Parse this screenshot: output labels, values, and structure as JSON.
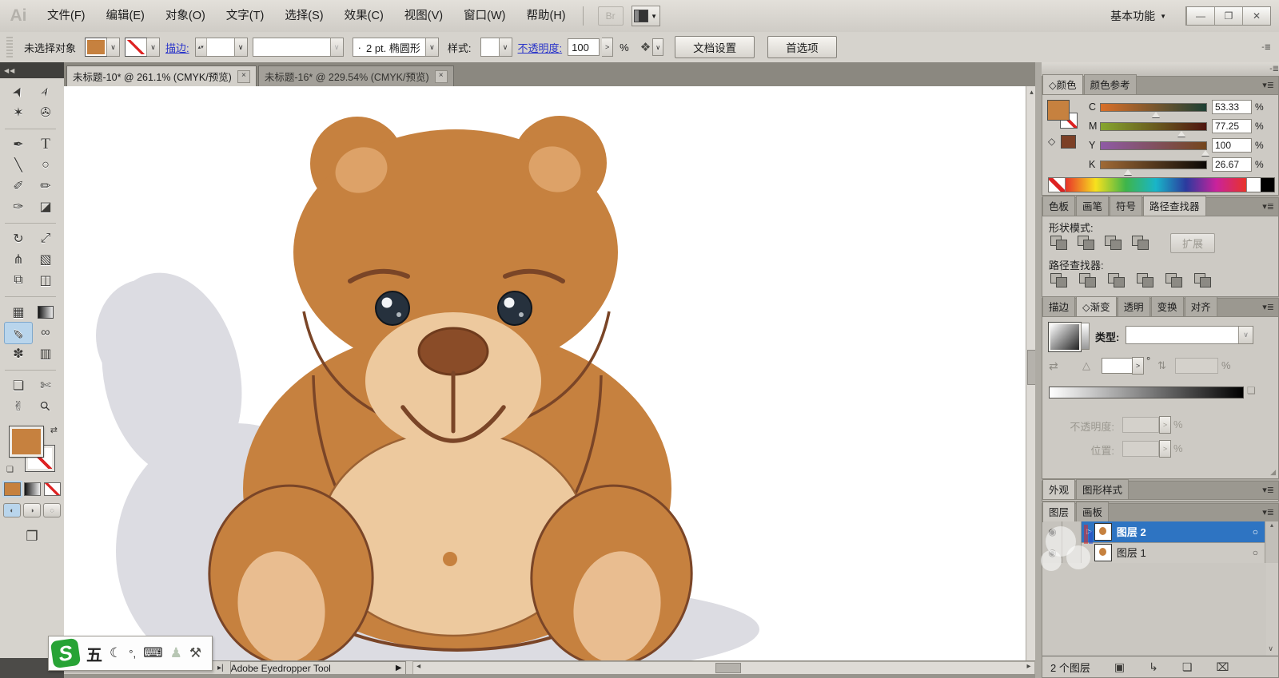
{
  "palette": {
    "ui": {
      "chrome": "#d6d3cd",
      "dark": "#8b8880",
      "panel": "#cdcac4",
      "link": "#2b35c9",
      "selBlue": "#2e74c2",
      "toolSel": "#b9d5ec",
      "scrollThumb": "#b5b2ac"
    },
    "bear": {
      "body": "#c6813f",
      "edge": "#7a4527",
      "inner": "#dda268",
      "muzzle": "#edc99e",
      "pad": "#e9bd90",
      "nose": "#8a4c28",
      "eye": "#26313d",
      "shadow": "#dcdce2"
    },
    "slider": {
      "c1": "#d96f28",
      "c2": "#1d4034",
      "m1": "#86a62e",
      "m2": "#4f1510",
      "y1": "#8f5ba6",
      "y2": "#74461c",
      "k1": "#a06a36",
      "k2": "#0a0806"
    }
  },
  "icons": {
    "dropdown": "∨",
    "spinner": "▴▾",
    "chevron_right": ">",
    "panel_menu": "▾≣",
    "collapse_left": "◀◀",
    "collapse_right": "-≣",
    "isolate": "❖",
    "swap": "⇄",
    "mini_swatches": "❏",
    "play": "▸|",
    "arrow_up": "▴",
    "arrow_down": "▾",
    "arrow_left": "◂",
    "arrow_right": "▸",
    "tool_flyout": "▶",
    "screen_mode": "❐",
    "cube": "◇",
    "reverse": "⇄",
    "angle": "△",
    "degree": "°",
    "aspect": "⇅",
    "gradient_pick": "❏",
    "eye": "◉",
    "target": "○",
    "expand": "▷",
    "clip_mask": "▣",
    "new_sublayer": "↳",
    "new_layer": "❏",
    "delete": "⌧",
    "min_glyph": "—",
    "max_glyph": "❐",
    "close_glyph": "✕",
    "resize_grip": "◢"
  },
  "menu_bar": {
    "logo": "Ai",
    "items": [
      "文件(F)",
      "编辑(E)",
      "对象(O)",
      "文字(T)",
      "选择(S)",
      "效果(C)",
      "视图(V)",
      "窗口(W)",
      "帮助(H)"
    ],
    "bridge_label": "Br",
    "workspace_label": "基本功能",
    "workspace_caret": "▼"
  },
  "control_bar": {
    "no_selection_label": "未选择对象",
    "stroke_link": "描边:",
    "brush_prefix": "·",
    "brush_value": "2 pt. 椭圆形",
    "style_label": "样式:",
    "opacity_link": "不透明度:",
    "opacity_value": "100",
    "percent": "%",
    "doc_setup_button": "文档设置",
    "preferences_button": "首选项"
  },
  "document_tabs": [
    {
      "title": "未标题-10* @ 261.1% (CMYK/预览)",
      "close": "×"
    },
    {
      "title": "未标题-16* @ 229.54% (CMYK/预览)",
      "close": "×"
    }
  ],
  "toolbar": {
    "tools": [
      {
        "name": "selection-tool",
        "glyph": "➤"
      },
      {
        "name": "direct-selection-tool",
        "glyph": "➢"
      },
      {
        "name": "magic-wand-tool",
        "glyph": "✶"
      },
      {
        "name": "lasso-tool",
        "glyph": "✇"
      },
      {
        "name": "pen-tool",
        "glyph": "✒"
      },
      {
        "name": "type-tool",
        "glyph": "T"
      },
      {
        "name": "line-segment-tool",
        "glyph": "╲"
      },
      {
        "name": "ellipse-tool",
        "glyph": "○"
      },
      {
        "name": "paintbrush-tool",
        "glyph": "✐"
      },
      {
        "name": "pencil-tool",
        "glyph": "✏"
      },
      {
        "name": "blob-brush-tool",
        "glyph": "✑"
      },
      {
        "name": "eraser-tool",
        "glyph": "◪"
      },
      {
        "name": "rotate-tool",
        "glyph": "↻"
      },
      {
        "name": "scale-tool",
        "glyph": "⤢"
      },
      {
        "name": "width-tool",
        "glyph": "⋔"
      },
      {
        "name": "free-transform-tool",
        "glyph": "▧"
      },
      {
        "name": "shape-builder-tool",
        "glyph": "⧉"
      },
      {
        "name": "perspective-grid-tool",
        "glyph": "◫"
      },
      {
        "name": "mesh-tool",
        "glyph": "▦"
      },
      {
        "name": "gradient-tool",
        "glyph": ""
      },
      {
        "name": "eyedropper-tool",
        "glyph": "✎"
      },
      {
        "name": "blend-tool",
        "glyph": "∞"
      },
      {
        "name": "symbol-sprayer-tool",
        "glyph": "✽"
      },
      {
        "name": "graph-tool",
        "glyph": "▥"
      },
      {
        "name": "artboard-tool",
        "glyph": "❏"
      },
      {
        "name": "slice-tool",
        "glyph": "✄"
      },
      {
        "name": "hand-tool",
        "glyph": "✌"
      },
      {
        "name": "zoom-tool",
        "glyph": "⚲"
      }
    ]
  },
  "color_panel": {
    "tab_color": "◇颜色",
    "tab_guide": "颜色参考",
    "channels": [
      {
        "label": "C",
        "value": "53.33",
        "pct": 53.33
      },
      {
        "label": "M",
        "value": "77.25",
        "pct": 77.25
      },
      {
        "label": "Y",
        "value": "100",
        "pct": 100
      },
      {
        "label": "K",
        "value": "26.67",
        "pct": 26.67
      }
    ],
    "unit": "%"
  },
  "pathfinder_panel": {
    "tab_swatches": "色板",
    "tab_brushes": "画笔",
    "tab_symbols": "符号",
    "tab_pathfinder": "路径查找器",
    "shape_modes_label": "形状模式:",
    "pathfinder_label": "路径查找器:",
    "expand_button": "扩展"
  },
  "gradient_panel": {
    "tab_stroke": "描边",
    "tab_gradient": "◇渐变",
    "tab_transparency": "透明",
    "tab_transform": "变换",
    "tab_align": "对齐",
    "type_label": "类型:",
    "opacity_label": "不透明度:",
    "location_label": "位置:",
    "unit": "%"
  },
  "appearance_strip": {
    "tab_appearance": "外观",
    "tab_graphic_styles": "图形样式"
  },
  "layers_panel": {
    "tab_layers": "图层",
    "tab_artboards": "画板",
    "rows": [
      {
        "name": "图层 2"
      },
      {
        "name": "图层 1"
      }
    ],
    "count_label": "2 个图层"
  },
  "status_bar": {
    "tool_name": "Adobe Eyedropper Tool"
  },
  "ime_bar": {
    "logo": "S",
    "mode": "五",
    "moon": "☾",
    "punct": "°,",
    "keyboard": "⌨",
    "person": "♟",
    "wrench": "⚒"
  }
}
